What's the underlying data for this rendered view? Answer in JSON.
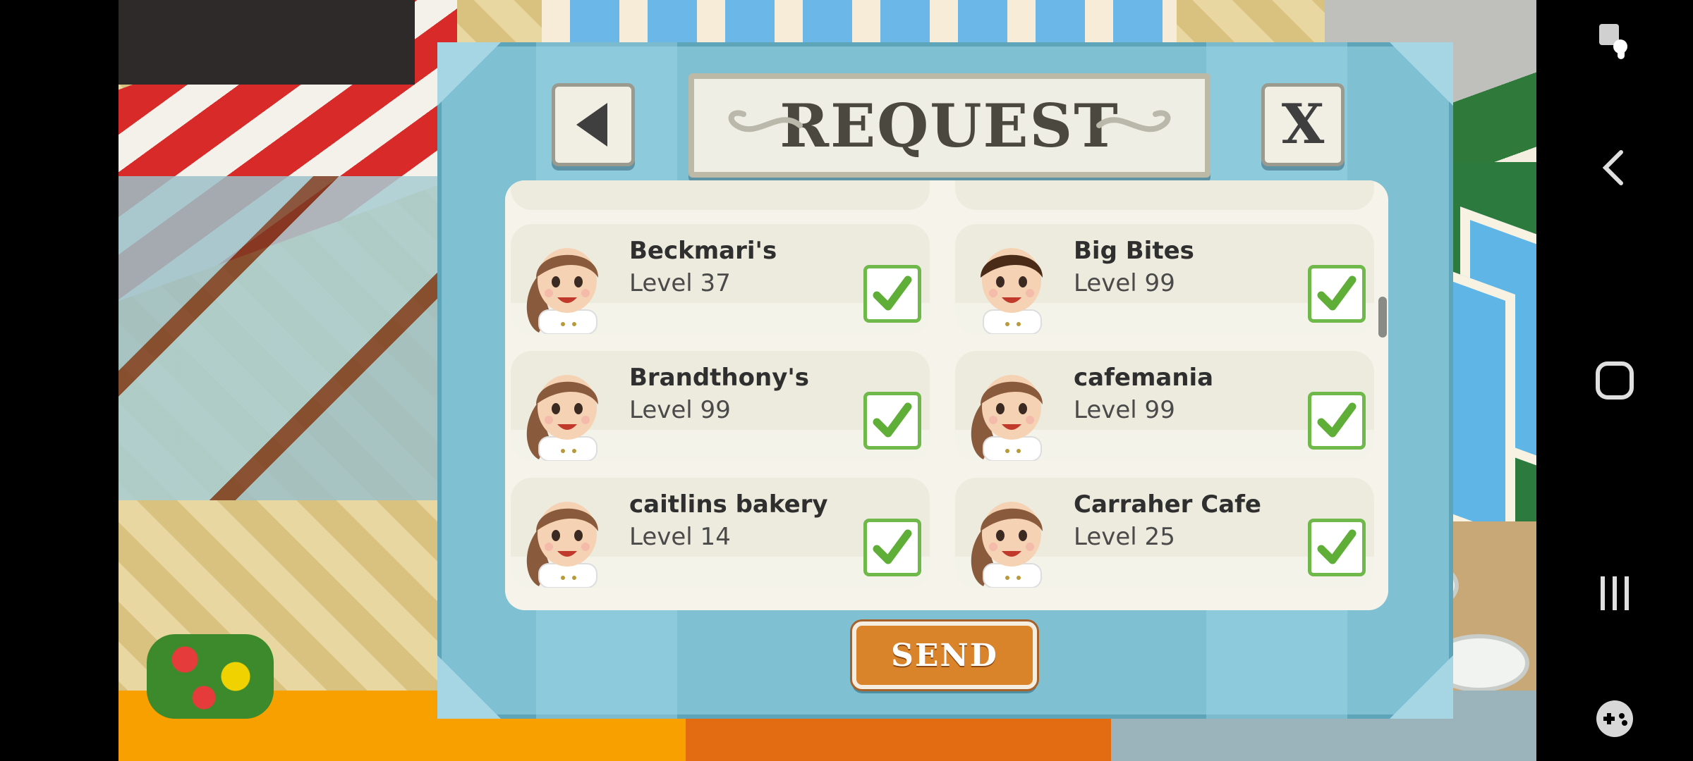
{
  "dialog": {
    "title": "REQUEST",
    "back_icon": "back-triangle-icon",
    "close_label": "X",
    "send_label": "SEND"
  },
  "friends": [
    {
      "name": "Beckmari's",
      "level": "Level 37",
      "avatar": "female-chef-icon",
      "checked": true
    },
    {
      "name": "Big Bites",
      "level": "Level 99",
      "avatar": "male-chef-icon",
      "checked": true
    },
    {
      "name": "Brandthony's",
      "level": "Level 99",
      "avatar": "female-chef-icon",
      "checked": true
    },
    {
      "name": "cafemania",
      "level": "Level 99",
      "avatar": "female-chef-icon",
      "checked": true
    },
    {
      "name": "caitlins bakery",
      "level": "Level 14",
      "avatar": "female-chef-icon",
      "checked": true
    },
    {
      "name": "Carraher Cafe",
      "level": "Level 25",
      "avatar": "female-chef-icon",
      "checked": true
    }
  ],
  "system_nav": {
    "icons": [
      "accessibility-touch-icon",
      "back-chevron-icon",
      "home-square-icon",
      "recents-icon",
      "game-controller-icon"
    ]
  },
  "colors": {
    "dialog_bg": "#7fc0d3",
    "check_green": "#5fae37",
    "send_orange": "#d9832b"
  }
}
